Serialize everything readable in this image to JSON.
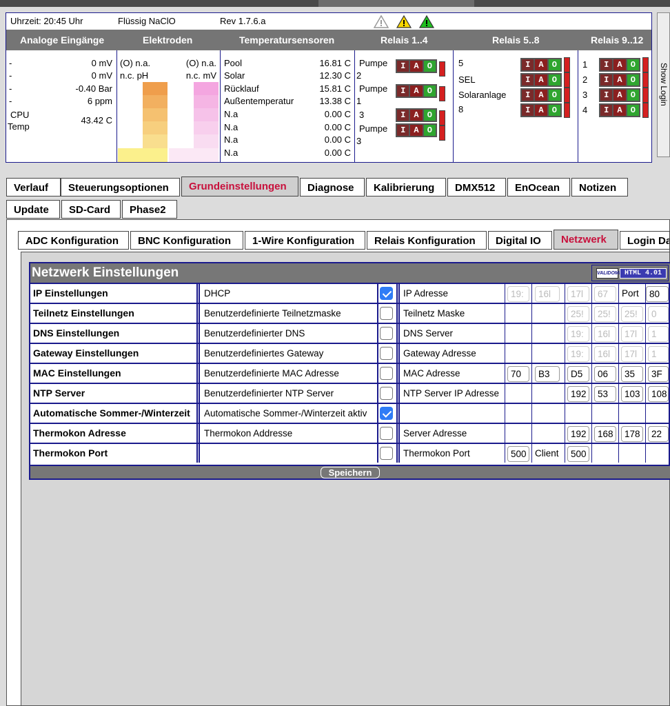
{
  "status": {
    "time": "Uhrzeit: 20:45 Uhr",
    "product": "Flüssig NaClO",
    "revision": "Rev 1.7.6.a",
    "warning_icons": [
      "warning-outline-icon",
      "warning-yellow-icon",
      "warning-green-icon"
    ]
  },
  "headers": {
    "analog": "Analoge Eingänge",
    "elektroden": "Elektroden",
    "temp": "Temperatursensoren",
    "relais1": "Relais 1..4",
    "relais2": "Relais 5..8",
    "relais3": "Relais 9..12"
  },
  "analog": {
    "rows": [
      {
        "label": "-",
        "value": "0 mV"
      },
      {
        "label": "-",
        "value": "0 mV"
      },
      {
        "label": "-",
        "value": "-0.40 Bar"
      },
      {
        "label": "-",
        "value": "6 ppm"
      }
    ],
    "cpu_label": "CPU",
    "temp_label": "Temp",
    "cpu_value": "43.42 C"
  },
  "elektroden": {
    "left_val": "(O) n.a.",
    "left_unit": "n.c. pH",
    "right_val": "(O) n.a.",
    "right_unit": "n.c. mV"
  },
  "temps": [
    {
      "name": "Pool",
      "value": "16.81 C"
    },
    {
      "name": "Solar",
      "value": "12.30 C"
    },
    {
      "name": "Rücklauf",
      "value": "15.81 C"
    },
    {
      "name": "Außentemperatur",
      "value": "13.38 C"
    },
    {
      "name": "N.a",
      "value": "0.00 C"
    },
    {
      "name": "N.a",
      "value": "0.00 C"
    },
    {
      "name": "N.a",
      "value": "0.00 C"
    },
    {
      "name": "N.a",
      "value": "0.00 C"
    }
  ],
  "relais1": {
    "labels": [
      "Pumpe",
      "2",
      "Pumpe",
      "1",
      "3",
      "Pumpe",
      "3"
    ]
  },
  "relais2": {
    "labels": [
      "5",
      "SEL",
      "Solaranlage",
      "8"
    ]
  },
  "relais3": {
    "labels": [
      "1",
      "2",
      "3",
      "4"
    ]
  },
  "iao": {
    "i": "I",
    "a": "A",
    "o": "O"
  },
  "show_login": "Show Login",
  "tabs_row1": [
    "Verlauf",
    "Steuerungsoptionen",
    "Grundeinstellungen",
    "Diagnose",
    "Kalibrierung",
    "DMX512",
    "EnOcean",
    "Notizen"
  ],
  "tabs_row2": [
    "Update",
    "SD-Card",
    "Phase2"
  ],
  "subtabs": [
    "ADC Konfiguration",
    "BNC Konfiguration",
    "1-Wire Konfiguration",
    "Relais Konfiguration",
    "Digital IO",
    "Netzwerk",
    "Login Da"
  ],
  "netz": {
    "title": "Netzwerk Einstellungen",
    "valid_logo": "VALIDOME",
    "valid_html": "HTML 4.01",
    "rows": [
      {
        "label": "IP Einstellungen",
        "desc": "DHCP",
        "checked": true,
        "field": "IP Adresse",
        "i5": "19:",
        "i6": "16l",
        "i7": "17l",
        "i8": "67",
        "port_label": "Port",
        "port_value": "80"
      },
      {
        "label": "Teilnetz Einstellungen",
        "desc": "Benutzerdefinierte Teilnetzmaske",
        "checked": false,
        "field": "Teilnetz Maske",
        "i7": "25!",
        "i8": "25!",
        "i9": "25!",
        "i10": "0"
      },
      {
        "label": "DNS Einstellungen",
        "desc": "Benutzerdefinierter DNS",
        "checked": false,
        "field": "DNS Server",
        "i7": "19:",
        "i8": "16l",
        "i9": "17l",
        "i10": "1"
      },
      {
        "label": "Gateway Einstellungen",
        "desc": "Benutzerdefiniertes Gateway",
        "checked": false,
        "field": "Gateway Adresse",
        "i7": "19:",
        "i8": "16l",
        "i9": "17l",
        "i10": "1"
      },
      {
        "label": "MAC Einstellungen",
        "desc": "Benutzerdefinierte MAC Adresse",
        "checked": false,
        "field": "MAC Adresse",
        "i5": "70",
        "i6": "B3",
        "i7": "D5",
        "i8": "06",
        "i9": "35",
        "i10": "3F"
      },
      {
        "label": "NTP Server",
        "desc": "Benutzerdefinierter NTP Server",
        "checked": false,
        "field": "NTP Server IP Adresse",
        "i7": "192",
        "i8": "53",
        "i9": "103",
        "i10": "108"
      },
      {
        "label": "Automatische Sommer-/Winterzeit",
        "desc": "Automatische Sommer-/Winterzeit aktiv",
        "checked": true,
        "field": ""
      },
      {
        "label": "Thermokon Adresse",
        "desc": "Thermokon Addresse",
        "checked": false,
        "field": "Server Adresse",
        "i7": "192",
        "i8": "168",
        "i9": "178",
        "i10": "22"
      },
      {
        "label": "Thermokon Port",
        "desc": "",
        "checked": false,
        "field": "Thermokon Port",
        "i5": "500",
        "client_label": "Client",
        "i7": "500"
      }
    ],
    "save_label": "Speichern"
  }
}
